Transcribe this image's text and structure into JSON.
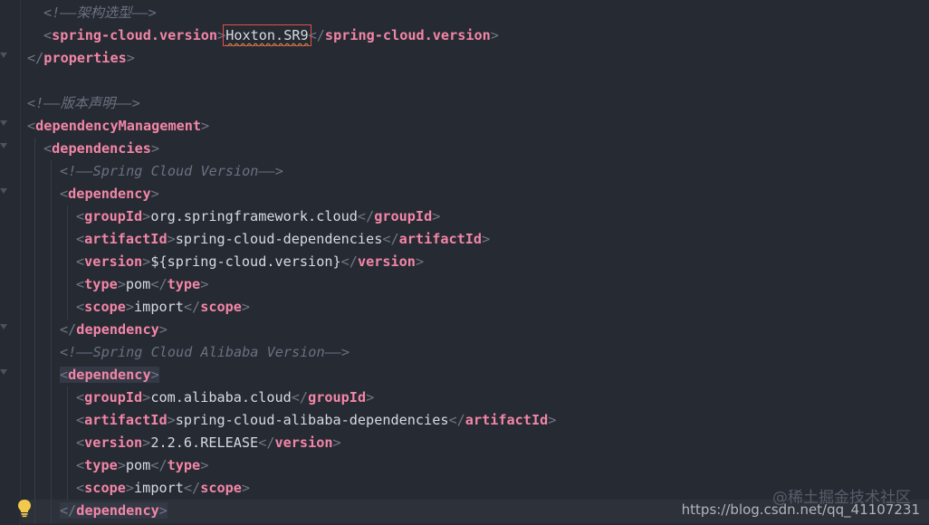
{
  "editor": {
    "lines": [
      {
        "indent": 1,
        "comment": "<!——架构选型——>"
      },
      {
        "indent": 1,
        "tag": "spring-cloud.version",
        "value": "Hoxton.SR9",
        "boxed": true
      },
      {
        "indent": 0,
        "close": "properties"
      },
      {
        "indent": 0,
        "blank": true
      },
      {
        "indent": 0,
        "comment": "<!——版本声明——>"
      },
      {
        "indent": 0,
        "open": "dependencyManagement"
      },
      {
        "indent": 1,
        "open": "dependencies"
      },
      {
        "indent": 2,
        "comment": "<!——Spring Cloud Version——>"
      },
      {
        "indent": 2,
        "open": "dependency"
      },
      {
        "indent": 3,
        "tag": "groupId",
        "value": "org.springframework.cloud"
      },
      {
        "indent": 3,
        "tag": "artifactId",
        "value": "spring-cloud-dependencies"
      },
      {
        "indent": 3,
        "tag": "version",
        "value": "${spring-cloud.version}"
      },
      {
        "indent": 3,
        "tag": "type",
        "value": "pom"
      },
      {
        "indent": 3,
        "tag": "scope",
        "value": "import"
      },
      {
        "indent": 2,
        "close": "dependency"
      },
      {
        "indent": 2,
        "comment": "<!——Spring Cloud Alibaba Version——>"
      },
      {
        "indent": 2,
        "open": "dependency",
        "highlight": true
      },
      {
        "indent": 3,
        "tag": "groupId",
        "value": "com.alibaba.cloud"
      },
      {
        "indent": 3,
        "tag": "artifactId",
        "value": "spring-cloud-alibaba-dependencies"
      },
      {
        "indent": 3,
        "tag": "version",
        "value": "2.2.6.RELEASE"
      },
      {
        "indent": 3,
        "tag": "type",
        "value": "pom"
      },
      {
        "indent": 3,
        "tag": "scope",
        "value": "import"
      },
      {
        "indent": 2,
        "close": "dependency",
        "highlight": true
      }
    ]
  },
  "watermark": {
    "line1": "@稀土掘金技术社区",
    "line2": "https://blog.csdn.net/qq_41107231"
  },
  "icons": {
    "bulb": "lightbulb-icon",
    "fold": "fold-arrow-icon"
  },
  "colors": {
    "background": "#262a33",
    "tag": "#f286a6",
    "bracket": "#6f7784",
    "text": "#d7dae0",
    "comment": "#6a7180",
    "boxOutline": "#e2504d"
  }
}
